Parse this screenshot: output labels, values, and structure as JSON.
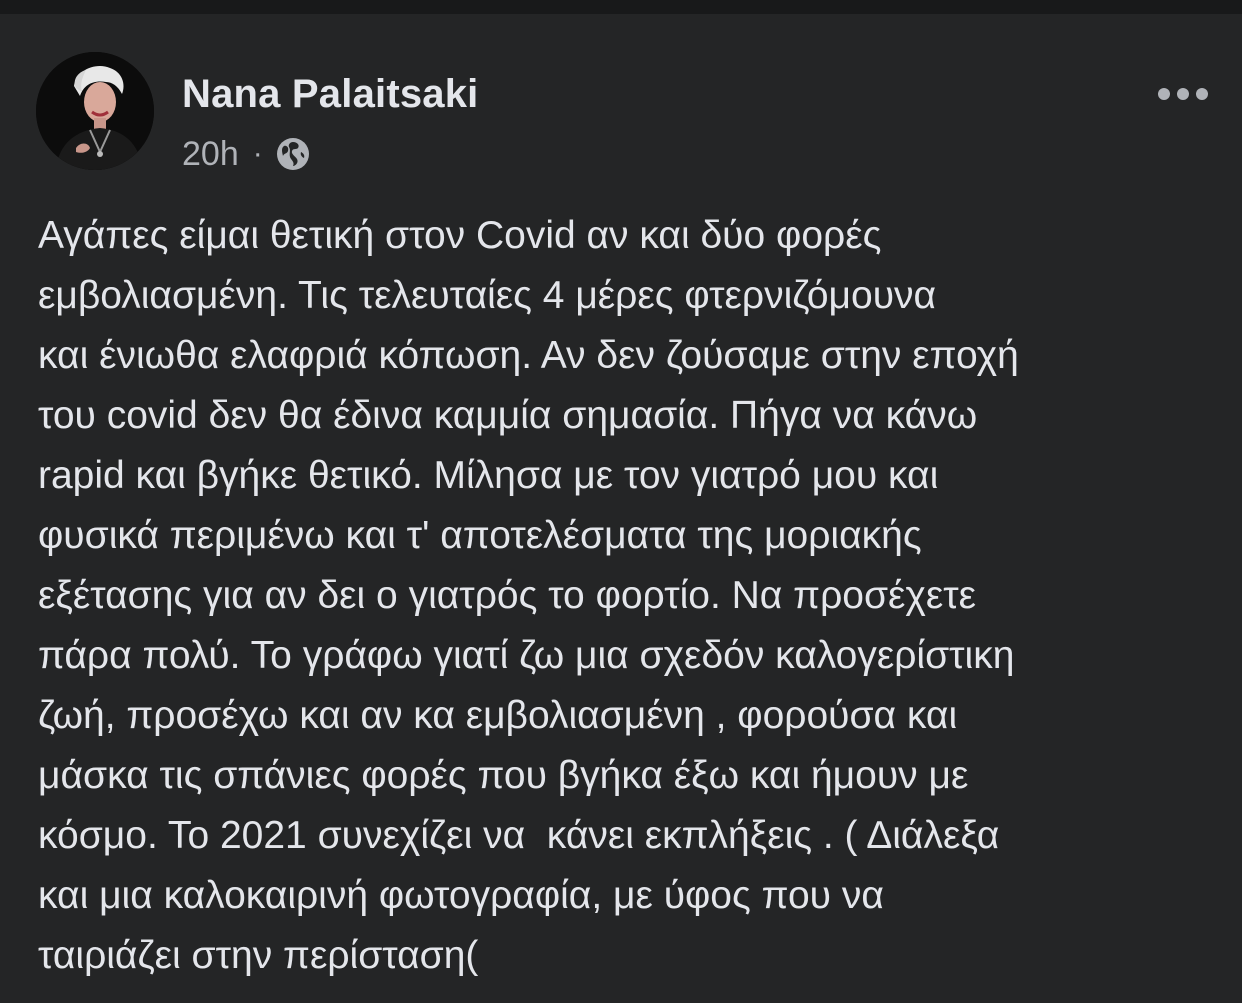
{
  "post": {
    "author": "Nana Palaitsaki",
    "time": "20h",
    "separator": "·",
    "privacy_icon": "globe-icon",
    "more_icon": "more-horizontal-icon",
    "text_lines": [
      "Αγάπες είμαι θετική στον Covid αν και δύο φορές",
      "εμβολιασμένη. Τις τελευταίες 4 μέρες φτερνιζόμουνα",
      "και ένιωθα ελαφριά κόπωση. Αν δεν ζούσαμε στην εποχή",
      "του covid δεν θα έδινα καμμία σημασία. Πήγα να κάνω",
      "rapid και βγήκε θετικό. Μίλησα με τον γιατρό μου και",
      "φυσικά περιμένω και τ' αποτελέσματα της μοριακής",
      "εξέτασης για αν δει ο γιατρός το φορτίο. Να προσέχετε",
      "πάρα πολύ. Το γράφω γιατί ζω μια σχεδόν καλογερίστικη",
      "ζωή, προσέχω και αν κα εμβολιασμένη , φορούσα και",
      "μάσκα τις σπάνιες φορές που βγήκα έξω και ήμουν με",
      "κόσμο. Το 2021 συνεχίζει να  κάνει εκπλήξεις . ( Διάλεξα",
      "και μια καλοκαιρινή φωτογραφία, με ύφος που να",
      "ταιριάζει στην περίσταση("
    ]
  },
  "colors": {
    "background": "#18191a",
    "card": "#242526",
    "primary_text": "#e4e6eb",
    "secondary_text": "#b0b3b8"
  }
}
